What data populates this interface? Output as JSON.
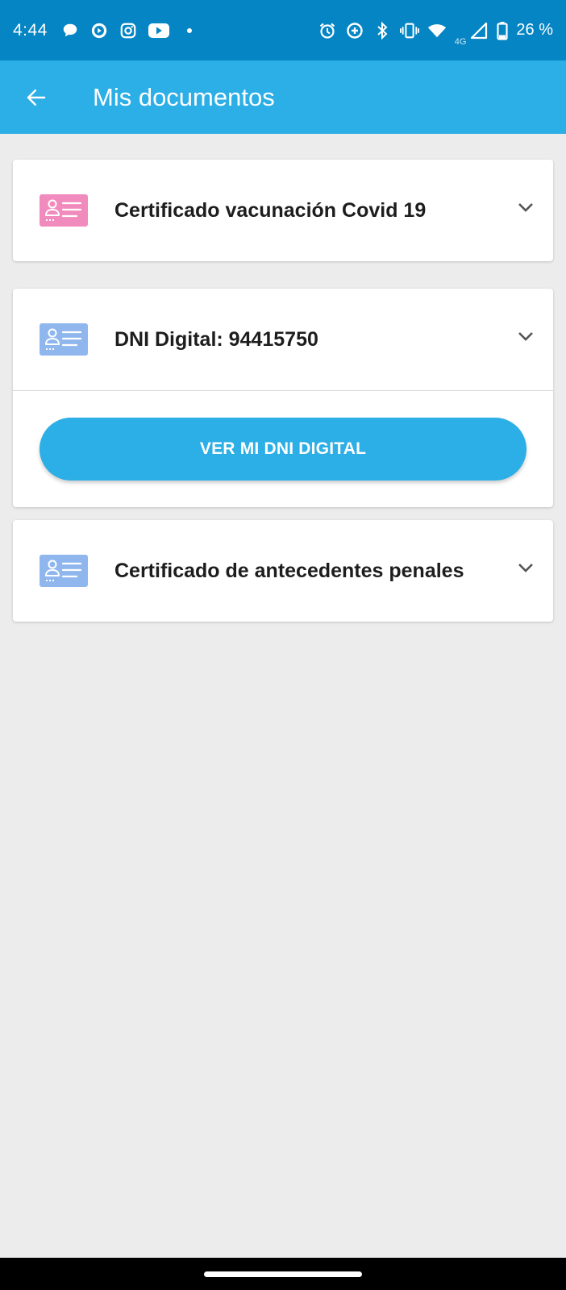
{
  "status_bar": {
    "time": "4:44",
    "network": "4G",
    "battery": "26 %",
    "left_icons": [
      "chat-bubble-icon",
      "play-circle-icon",
      "instagram-icon",
      "youtube-icon",
      "dot-icon"
    ],
    "right_icons": [
      "alarm-icon",
      "data-saver-icon",
      "bluetooth-icon",
      "vibrate-icon",
      "wifi-icon",
      "signal-icon",
      "battery-icon"
    ]
  },
  "app_bar": {
    "title": "Mis documentos",
    "back_icon": "arrow-left-icon"
  },
  "documents": [
    {
      "title": "Certificado vacunación Covid 19",
      "icon": "id-card-icon",
      "icon_color": "#f28bbd",
      "expanded": false
    },
    {
      "title": "DNI Digital: 94415750",
      "icon": "id-card-icon",
      "icon_color": "#8fb7ee",
      "expanded": true,
      "action_label": "VER MI DNI DIGITAL"
    },
    {
      "title": "Certificado de antecedentes penales",
      "icon": "id-card-icon",
      "icon_color": "#8fb7ee",
      "expanded": false
    }
  ],
  "colors": {
    "status_bar": "#0585c4",
    "app_bar": "#2caee6",
    "background": "#ececec",
    "button": "#2caee6"
  }
}
